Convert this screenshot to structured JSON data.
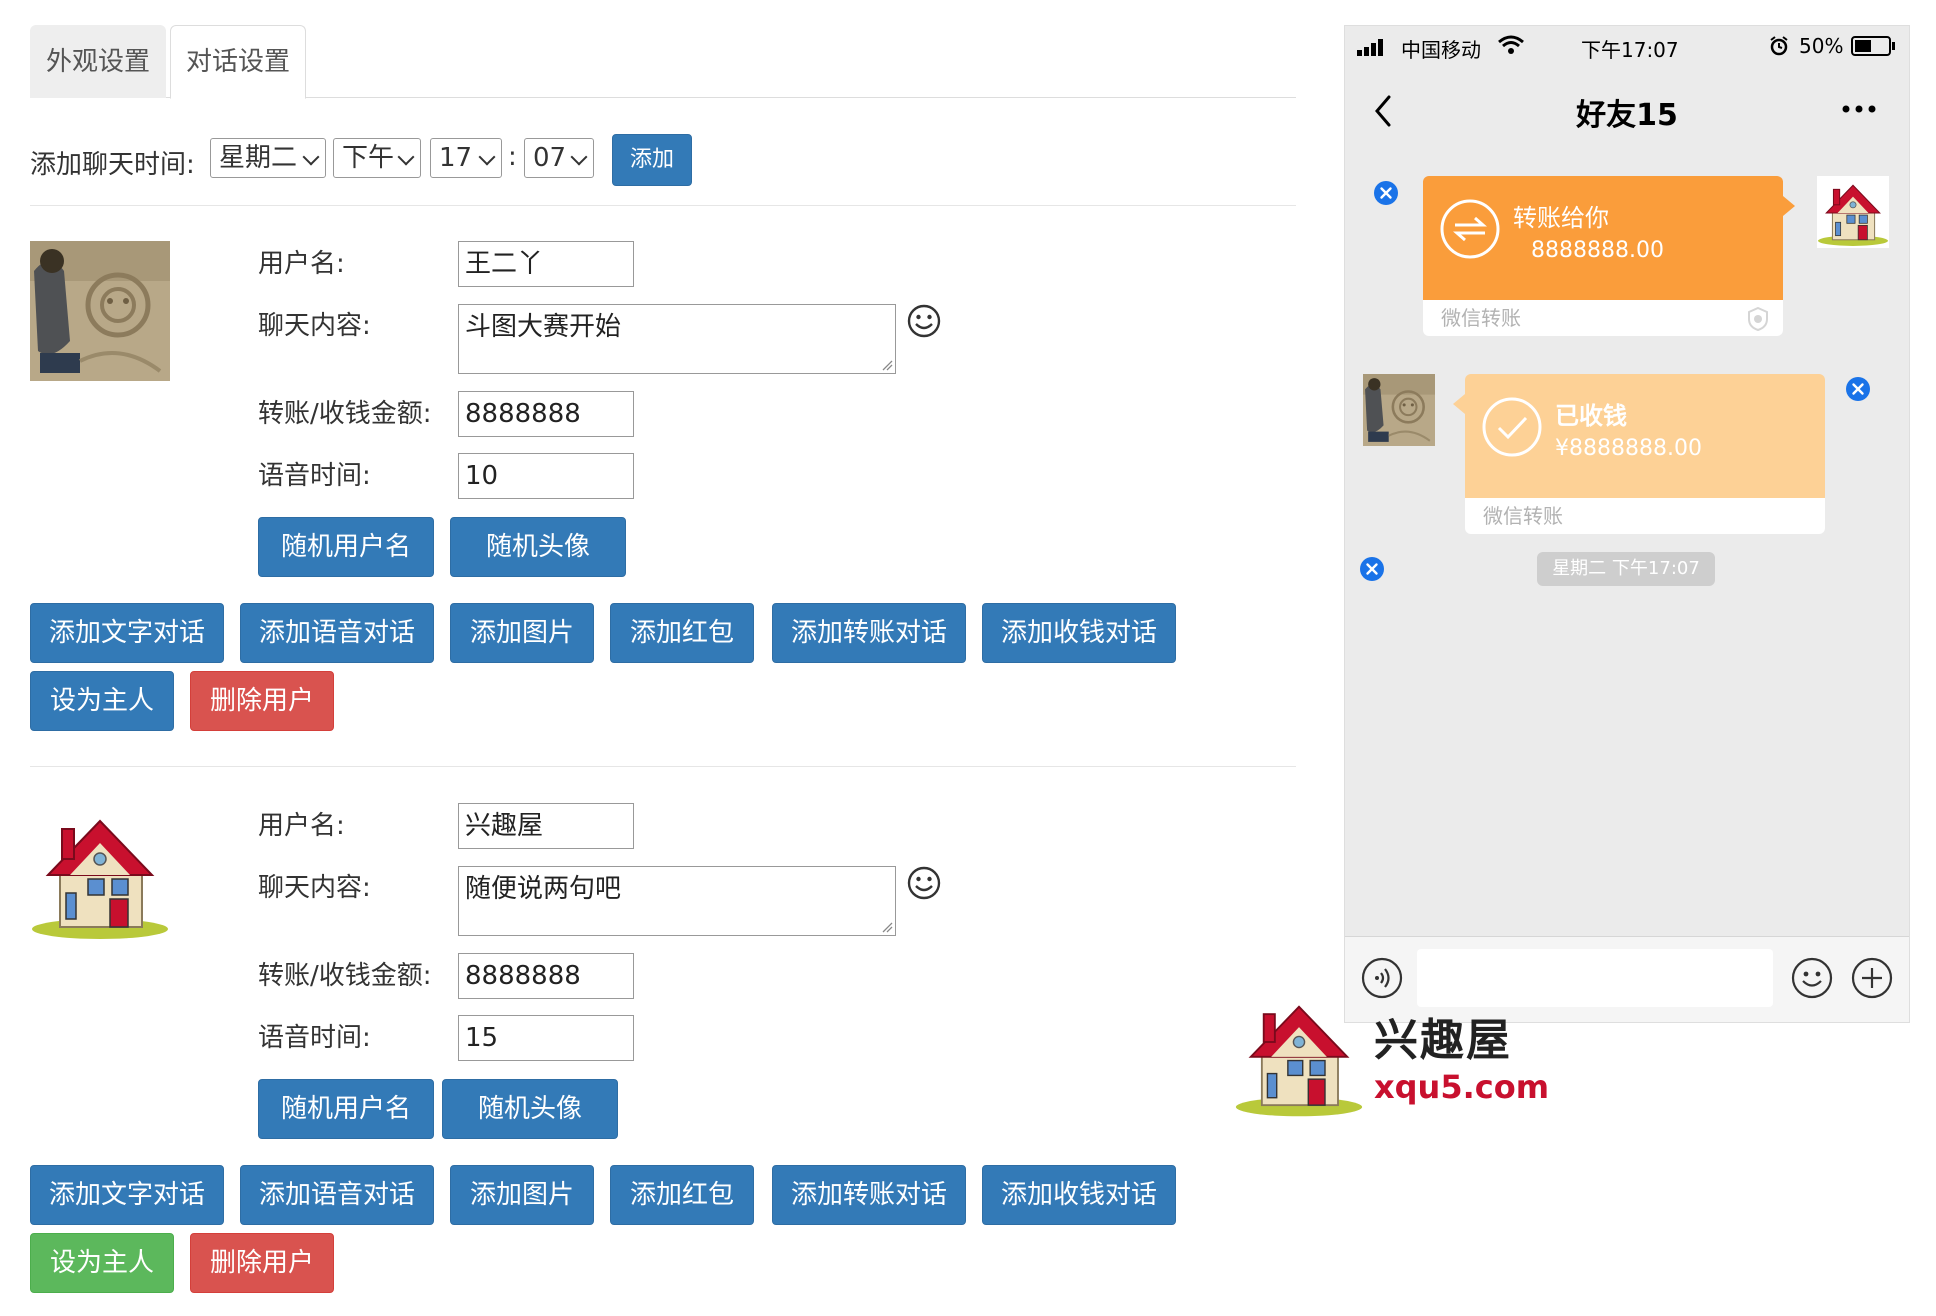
{
  "tabs": [
    {
      "label": "外观设置",
      "active": false
    },
    {
      "label": "对话设置",
      "active": true
    }
  ],
  "time_row": {
    "label": "添加聊天时间:",
    "weekday": "星期二",
    "ampm": "下午",
    "hour": "17",
    "sep": ":",
    "minute": "07",
    "add_label": "添加"
  },
  "labels": {
    "username": "用户名:",
    "content": "聊天内容:",
    "amount": "转账/收钱金额:",
    "voice": "语音时间:",
    "random_name": "随机用户名",
    "random_avatar": "随机头像",
    "add_text": "添加文字对话",
    "add_voice": "添加语音对话",
    "add_image": "添加图片",
    "add_redpacket": "添加红包",
    "add_transfer": "添加转账对话",
    "add_receive": "添加收钱对话",
    "set_owner": "设为主人",
    "delete_user": "删除用户"
  },
  "users": [
    {
      "avatar": "sand-photo-avatar",
      "username": "王二丫",
      "content": "斗图大赛开始",
      "amount": "8888888",
      "voice": "10",
      "is_owner": false
    },
    {
      "avatar": "house-avatar",
      "username": "兴趣屋",
      "content": "随便说两句吧",
      "amount": "8888888",
      "voice": "15",
      "is_owner": true
    }
  ],
  "phone": {
    "carrier": "中国移动",
    "clock": "下午17:07",
    "battery": "50%",
    "chat_title": "好友15",
    "messages": [
      {
        "type": "transfer",
        "side": "right",
        "title": "转账给你",
        "amount": "8888888.00",
        "footer": "微信转账"
      },
      {
        "type": "received",
        "side": "left",
        "title": "已收钱",
        "amount": "¥8888888.00",
        "footer": "微信转账"
      },
      {
        "type": "time",
        "text": "星期二 下午17:07"
      }
    ]
  },
  "colors": {
    "primary": "#337ab7",
    "danger": "#d9534f",
    "success": "#5cb85c",
    "transfer_orange": "#fa9d3b",
    "received_light": "#fdd196",
    "delete_blue": "#1a73e8"
  },
  "watermark": {
    "name": "兴趣屋",
    "url": "xqu5.com"
  }
}
